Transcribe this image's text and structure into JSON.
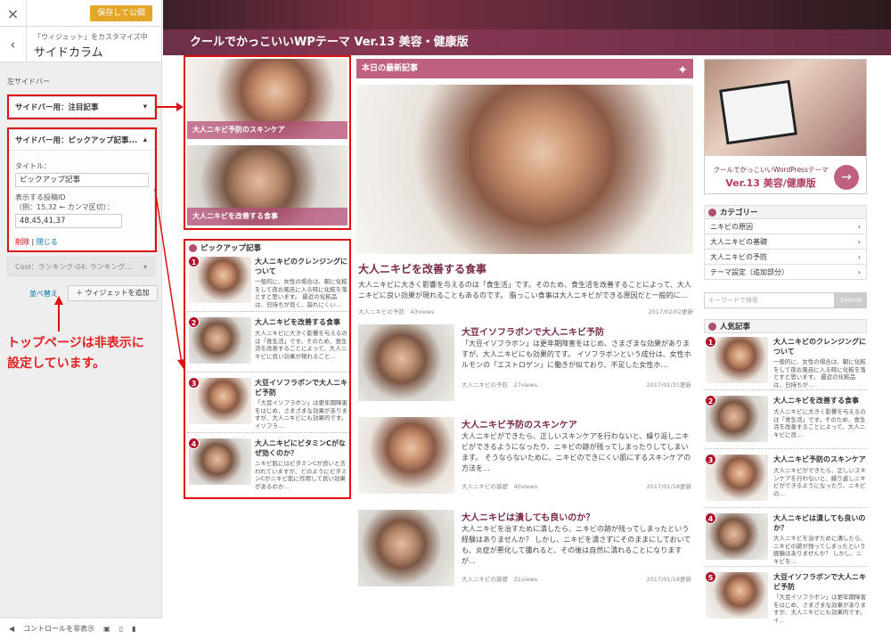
{
  "panel": {
    "close_icon": "×",
    "save_label": "保存して公開",
    "back_icon": "‹",
    "crumb_sub": "「ウィジェット」をカスタマイズ中",
    "crumb_title": "サイドカラム",
    "area_label": "左サイドバー",
    "widget1_title": "サイドバー用：注目記事",
    "widget2_title": "サイドバー用：ピックアップ記事...",
    "title_label": "タイトル：",
    "title_value": "ピックアップ記事",
    "ids_label": "表示する投稿ID",
    "ids_hint": "（例：15,32 ← カンマ区切）：",
    "ids_value": "48,45,41,37",
    "delete_label": "削除",
    "separator": " | ",
    "close_label": "閉じる",
    "widget3_title": "Cool：ランキング-04: ランキング...",
    "reorder_label": "並べ替え",
    "add_widget_label": "＋ ウィジェットを追加",
    "note_line1": "トップページは非表示に",
    "note_line2": "設定しています。",
    "hide_controls": "コントロールを非表示"
  },
  "hero": {
    "title": "クールでかっこいいWPテーマ Ver.13 美容・健康版"
  },
  "featured": [
    {
      "caption": "大人ニキビ予防のスキンケア"
    },
    {
      "caption": "大人ニキビを改善する食事"
    }
  ],
  "pickup": {
    "heading": "ピックアップ記事",
    "items": [
      {
        "num": "1",
        "title": "大人ニキビのクレンジングについて",
        "excerpt": "一般的に、女性の場合は、朝に化粧をして夜お風呂に入る時に化粧を落とすと思います。 最近の化粧品は、日持ちが良く、崩れにくい…"
      },
      {
        "num": "2",
        "title": "大人ニキビを改善する食事",
        "excerpt": "大人ニキビに大きく影響を与えるのは「食生活」です。そのため、食生活を改善することによって、大人ニキビに良い効果が現れること…"
      },
      {
        "num": "3",
        "title": "大豆イソフラボンで大人ニキビ予防",
        "excerpt": "「大豆イソフラボン」は更年期障害をはじめ、さまざまな効果がありますが、大人ニキビにも効果的です。 イソフラ…"
      },
      {
        "num": "4",
        "title": "大人ニキビにビタミンCがなぜ効くのか？",
        "excerpt": "ニキビ肌にはビタミンCが良いと言われていますが、どのようにビタミンCがニキビ肌に作用して良い効果があるのか…"
      }
    ]
  },
  "main": {
    "section_title": "本日の最新記事",
    "spark_icon": "✦",
    "big": {
      "title": "大人ニキビを改善する食事",
      "excerpt": "大人ニキビに大きく影響を与えるのは「食生活」です。そのため、食生活を改善することによって、大人ニキビに良い効果が現れることもあるのです。 脂っこい食事は大人ニキビができる原因だと一般的に…",
      "cat": "大人ニキビの予防",
      "views": "43views",
      "date": "2017/02/02更新"
    },
    "articles": [
      {
        "title": "大豆イソフラボンで大人ニキビ予防",
        "excerpt": "「大豆イソフラボン」は更年期障害をはじめ、さまざまな効果がありますが、大人ニキビにも効果的です。 イソフラボンという成分は、女性ホルモンの「エストロゲン」に働きが似ており、不足した女性ホ…",
        "cat": "大人ニキビの予防",
        "views": "27views",
        "date": "2017/01/31更新"
      },
      {
        "title": "大人ニキビ予防のスキンケア",
        "excerpt": "大人ニキビができたら、正しいスキンケアを行わないと、繰り返しニキビができるようになったり、ニキビの跡が残ってしまったりしてしまいます。 そうならないために、ニキビのできにくい肌にするスキンケアの方法を…",
        "cat": "大人ニキビの基礎",
        "views": "40views",
        "date": "2017/01/18更新"
      },
      {
        "title": "大人ニキビは潰しても良いのか？",
        "excerpt": "大人ニキビを治すために潰したら、ニキビの跡が残ってしまったという経験はありませんか？ しかし、ニキビを潰さずにそのままにしておいても、炎症が悪化して腫れると、その後は自然に潰れることになりますが…",
        "cat": "大人ニキビの基礎",
        "views": "31views",
        "date": "2017/01/18更新"
      }
    ]
  },
  "right": {
    "banner_line1": "クールでかっこいいWordPressテーマ",
    "banner_line2": "Ver.13 美容/健康版",
    "arrow_icon": "→",
    "category_heading": "カテゴリー",
    "categories": [
      "ニキビの原因",
      "大人ニキビの基礎",
      "大人ニキビの予防",
      "テーマ設定（追加部分）"
    ],
    "chevron": "›",
    "search_placeholder": "キーワードで検索",
    "search_button": "Search",
    "popular_heading": "人気記事",
    "popular": [
      {
        "num": "1",
        "title": "大人ニキビのクレンジングについて",
        "excerpt": "一般的に、女性の場合は、朝に化粧をして夜お風呂に入る時に化粧を落とすと思います。 最近の化粧品は、日持ちが…"
      },
      {
        "num": "2",
        "title": "大人ニキビを改善する食事",
        "excerpt": "大人ニキビに大きく影響を与えるのは「食生活」です。そのため、食生活を改善することによって、大人ニキビに良…"
      },
      {
        "num": "3",
        "title": "大人ニキビ予防のスキンケア",
        "excerpt": "大人ニキビができたら、正しいスキンケアを行わないと、繰り返しニキビができるようになったり、ニキビの…"
      },
      {
        "num": "4",
        "title": "大人ニキビは潰しても良いのか？",
        "excerpt": "大人ニキビを治すために潰したら、ニキビの跡が残ってしまったという経験はありませんか？ しかし、ニキビを…"
      },
      {
        "num": "5",
        "title": "大豆イソフラボンで大人ニキビ予防",
        "excerpt": "「大豆イソフラボン」は更年期障害をはじめ、さまざまな効果がありますが、大人ニキビにも効果的です。 イ…"
      }
    ]
  },
  "colors": {
    "accent": "#c0607f",
    "annotation_red": "#e01010",
    "save": "#e4a628"
  }
}
